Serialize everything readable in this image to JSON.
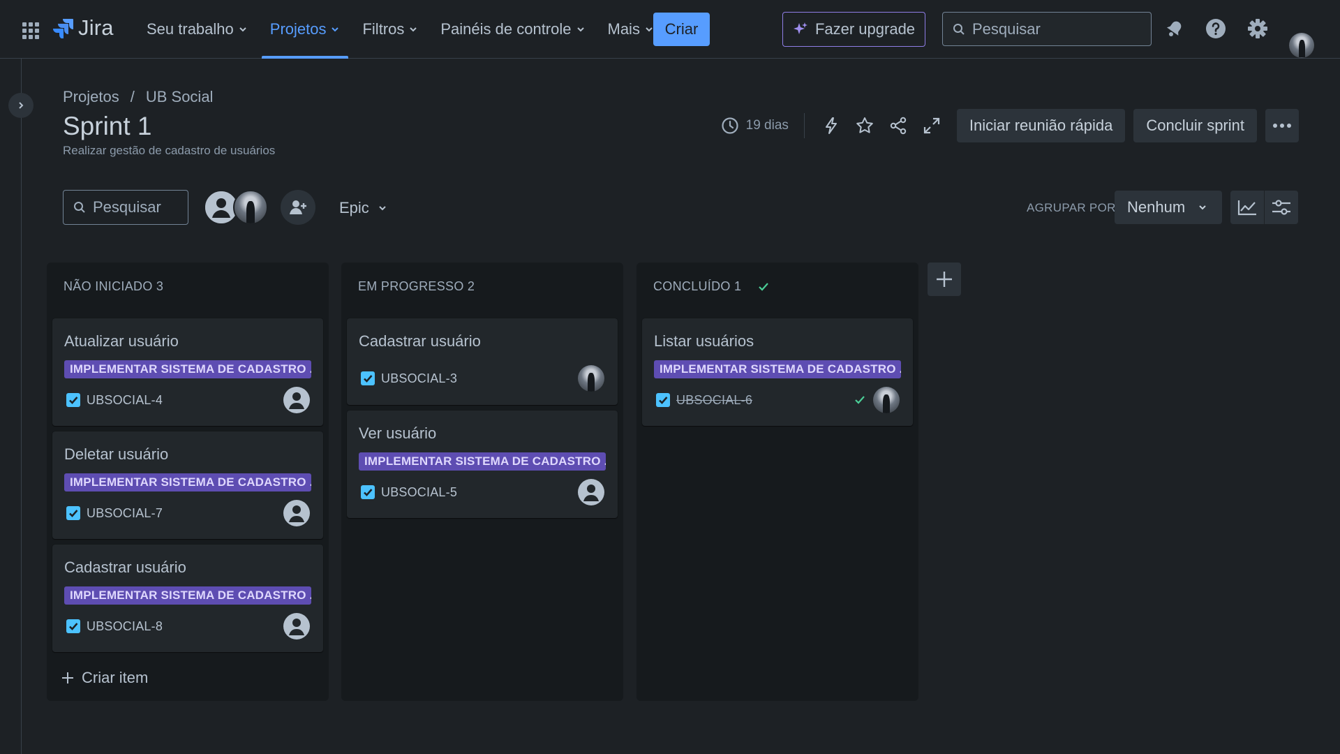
{
  "nav": {
    "logo_text": "Jira",
    "items": [
      {
        "label": "Seu trabalho"
      },
      {
        "label": "Projetos"
      },
      {
        "label": "Filtros"
      },
      {
        "label": "Painéis de controle"
      },
      {
        "label": "Mais"
      }
    ],
    "active_index": 1,
    "create_label": "Criar",
    "upgrade_label": "Fazer upgrade",
    "search_placeholder": "Pesquisar"
  },
  "breadcrumb": [
    "Projetos",
    "/",
    "UB Social"
  ],
  "sprint": {
    "title": "Sprint 1",
    "goal": "Realizar gestão de cadastro de usuários",
    "days_remaining": "19 dias",
    "start_meeting_label": "Iniciar reunião rápida",
    "complete_label": "Concluir sprint"
  },
  "toolbar": {
    "search_placeholder": "Pesquisar",
    "epic_filter_label": "Epic",
    "group_by_label": "AGRUPAR POR",
    "group_by_value": "Nenhum"
  },
  "columns": [
    {
      "title": "NÃO INICIADO 3",
      "cards": [
        {
          "title": "Atualizar usuário",
          "epic": "IMPLEMENTAR SISTEMA DE CADASTRO ...",
          "key": "UBSOCIAL-4",
          "assignee": "unassigned"
        },
        {
          "title": "Deletar usuário",
          "epic": "IMPLEMENTAR SISTEMA DE CADASTRO ...",
          "key": "UBSOCIAL-7",
          "assignee": "unassigned"
        },
        {
          "title": "Cadastrar usuário",
          "epic": "IMPLEMENTAR SISTEMA DE CADASTRO ...",
          "key": "UBSOCIAL-8",
          "assignee": "unassigned"
        }
      ],
      "create_item_label": "Criar item"
    },
    {
      "title": "EM PROGRESSO 2",
      "cards": [
        {
          "title": "Cadastrar usuário",
          "epic": "",
          "key": "UBSOCIAL-3",
          "assignee": "user-photo"
        },
        {
          "title": "Ver usuário",
          "epic": "IMPLEMENTAR SISTEMA DE CADASTRO ...",
          "key": "UBSOCIAL-5",
          "assignee": "unassigned"
        }
      ]
    },
    {
      "title": "CONCLUÍDO 1",
      "done_icon": "check-icon",
      "cards": [
        {
          "title": "Listar usuários",
          "epic": "IMPLEMENTAR SISTEMA DE CADASTRO ...",
          "key": "UBSOCIAL-6",
          "assignee": "user-photo",
          "done": true
        }
      ]
    }
  ],
  "colors": {
    "background": "#1d2125",
    "accent": "#579dff",
    "epic_badge": "#5e4db2",
    "done_green": "#4bce97",
    "upgrade_border": "#8f7ee7"
  },
  "icons": [
    "app-switcher-icon",
    "jira-logo-icon",
    "chevron-down-icon",
    "sparkle-icon",
    "search-icon",
    "notification-icon",
    "help-icon",
    "settings-icon",
    "clock-icon",
    "lightning-icon",
    "star-icon",
    "share-icon",
    "fullscreen-icon",
    "more-icon",
    "add-people-icon",
    "insights-icon",
    "view-settings-icon",
    "checkbox-icon",
    "check-icon",
    "plus-icon"
  ]
}
